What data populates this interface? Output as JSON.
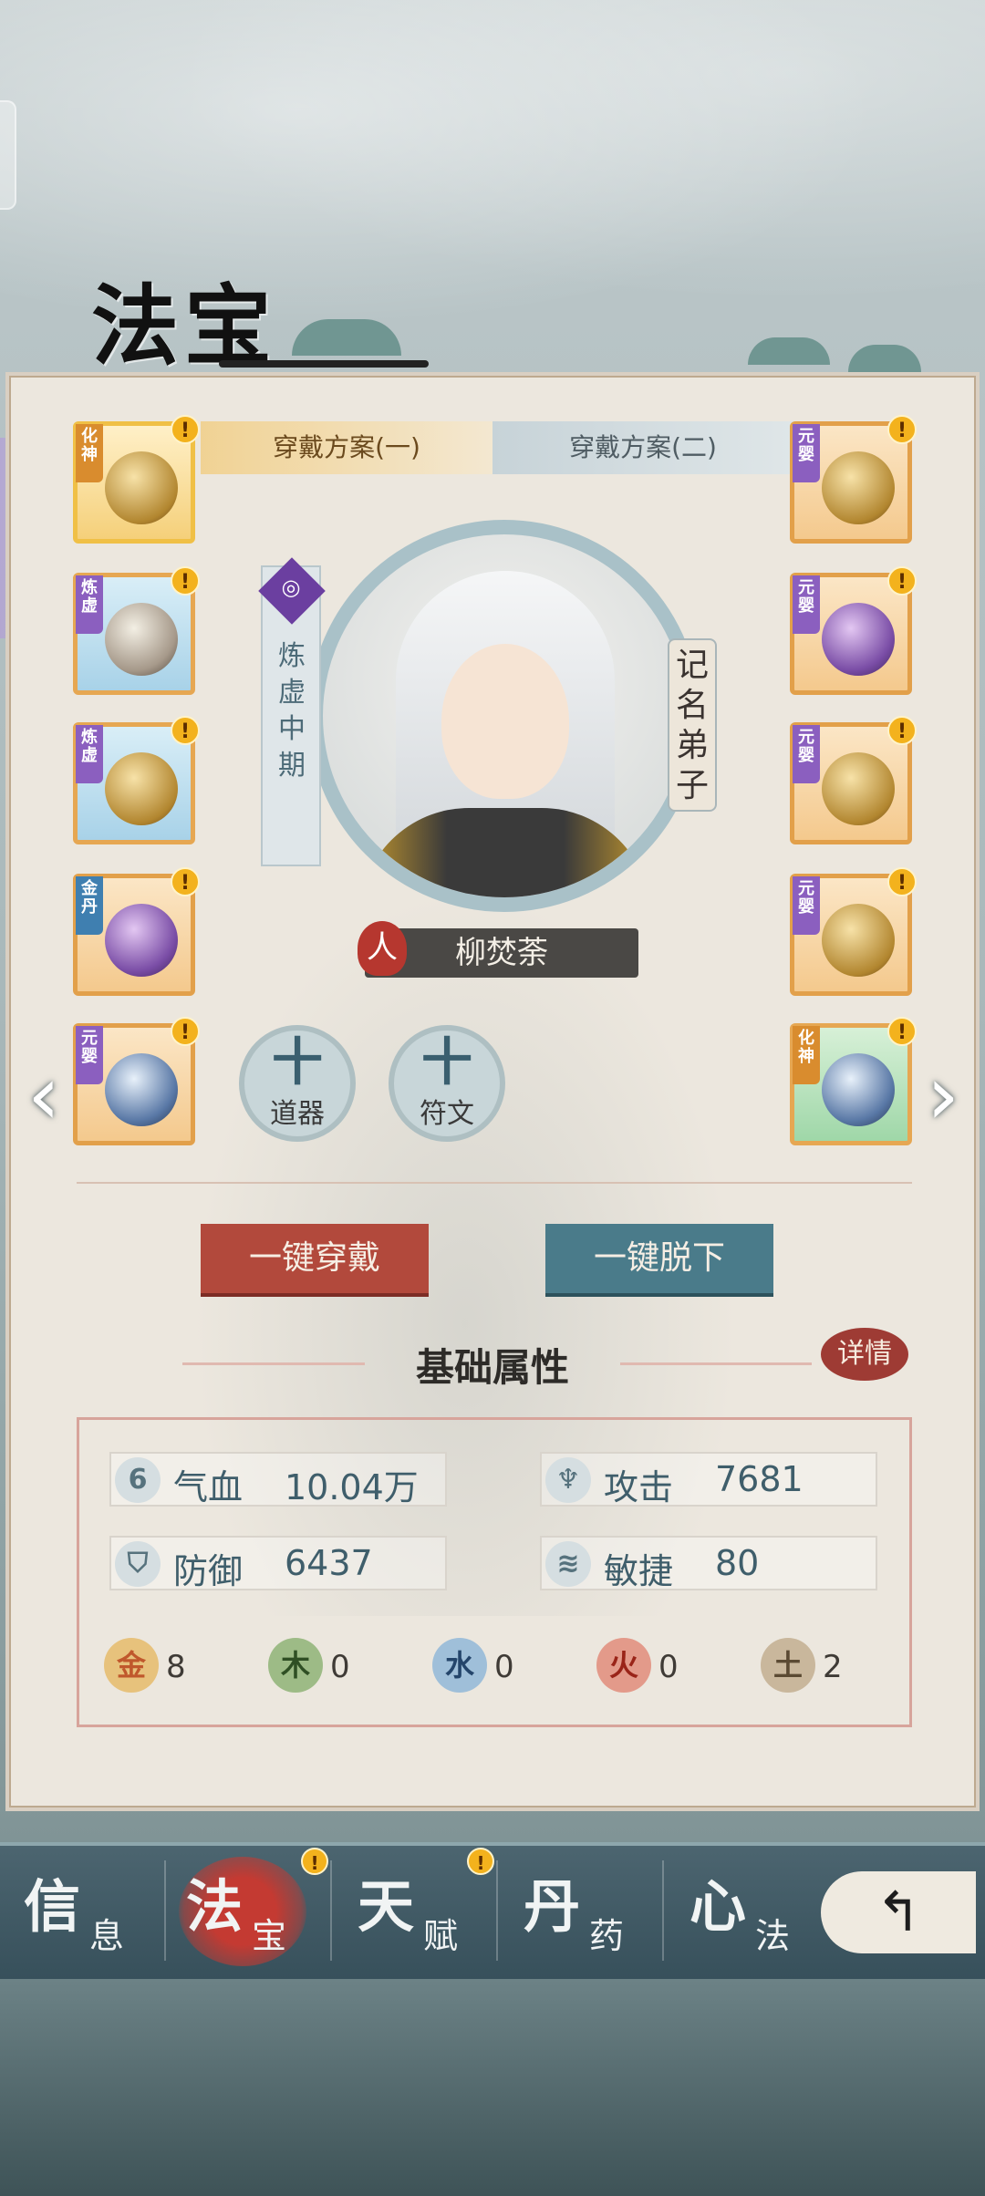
{
  "title": "法宝",
  "plans": {
    "tab1": "穿戴方案(一)",
    "tab2": "穿戴方案(二)"
  },
  "left_slots": [
    {
      "tier": "化神",
      "alert": "!"
    },
    {
      "tier": "炼虚",
      "alert": "!"
    },
    {
      "tier": "炼虚",
      "alert": "!"
    },
    {
      "tier": "金丹",
      "alert": "!"
    },
    {
      "tier": "元婴",
      "alert": "!"
    }
  ],
  "right_slots": [
    {
      "tier": "元婴",
      "alert": "!"
    },
    {
      "tier": "元婴",
      "alert": "!"
    },
    {
      "tier": "元婴",
      "alert": "!"
    },
    {
      "tier": "元婴",
      "alert": "!"
    },
    {
      "tier": "化神",
      "alert": "!"
    }
  ],
  "character": {
    "realm": "炼虚中期",
    "rank": "记名弟子",
    "race": "人",
    "name": "柳焚荼"
  },
  "add_buttons": {
    "tool_plus": "十",
    "tool_label": "道器",
    "rune_plus": "十",
    "rune_label": "符文"
  },
  "actions": {
    "equip_all": "一键穿戴",
    "remove_all": "一键脱下"
  },
  "attributes": {
    "section_title": "基础属性",
    "details": "详情",
    "hp_label": "气血",
    "hp_value": "10.04万",
    "attack_label": "攻击",
    "attack_value": "7681",
    "defense_label": "防御",
    "defense_value": "6437",
    "agility_label": "敏捷",
    "agility_value": "80"
  },
  "elements": [
    {
      "name": "金",
      "value": "8",
      "color": "#e7c27c"
    },
    {
      "name": "木",
      "value": "0",
      "color": "#9dbb86"
    },
    {
      "name": "水",
      "value": "0",
      "color": "#9fbfd9"
    },
    {
      "name": "火",
      "value": "0",
      "color": "#e39a8a"
    },
    {
      "name": "土",
      "value": "2",
      "color": "#c9b79c"
    }
  ],
  "nav": {
    "info_big": "信",
    "info_small": "息",
    "treasure_big": "法",
    "treasure_small": "宝",
    "talent_big": "天",
    "talent_small": "赋",
    "pill_big": "丹",
    "pill_small": "药",
    "heart_big": "心",
    "heart_small": "法",
    "alert": "!",
    "back": "↰"
  },
  "arrows": {
    "prev": "‹",
    "next": "›"
  }
}
